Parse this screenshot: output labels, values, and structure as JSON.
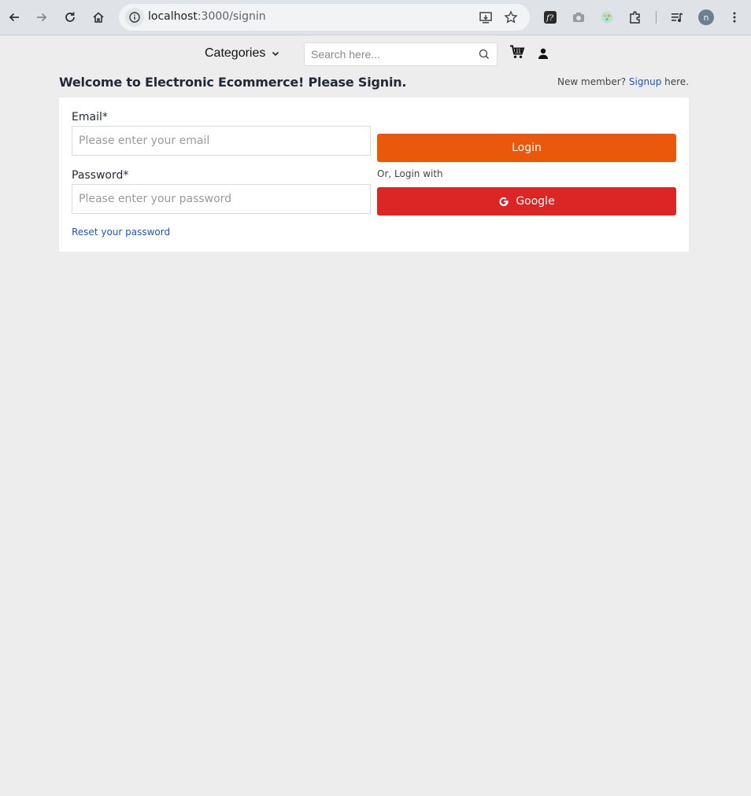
{
  "browser": {
    "url_host": "localhost",
    "url_path": ":3000/signin",
    "profile_initial": "n"
  },
  "header": {
    "categories_label": "Categories",
    "search_placeholder": "Search here...",
    "icons": [
      "cart-icon",
      "user-icon",
      "search-icon",
      "chevron-down-icon"
    ]
  },
  "page": {
    "welcome": "Welcome to Electronic Ecommerce! Please Signin.",
    "new_member_prefix": "New member? ",
    "signup_link": "Signup",
    "new_member_suffix": " here."
  },
  "form": {
    "email_label": "Email*",
    "email_placeholder": "Please enter your email",
    "password_label": "Password*",
    "password_placeholder": "Please enter your password",
    "login_button": "Login",
    "or_login_with": "Or, Login with",
    "google_button": "Google",
    "reset_link": "Reset your password"
  },
  "colors": {
    "login": "#ea580c",
    "google": "#dc2626",
    "link": "#1a56db",
    "background": "#ededed"
  }
}
